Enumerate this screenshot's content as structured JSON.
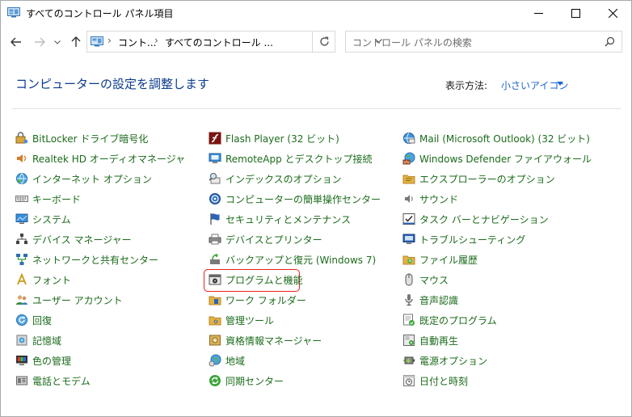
{
  "window": {
    "title": "すべてのコントロール パネル項目"
  },
  "address": {
    "crumbs": [
      "コント...",
      "すべてのコントロール ..."
    ],
    "search_placeholder": "コントロール パネルの検索"
  },
  "header": {
    "title": "コンピューターの設定を調整します",
    "view_label": "表示方法:",
    "view_value": "小さいアイコン"
  },
  "colors": {
    "link": "#1c6b1c",
    "accent": "#1a66d6",
    "highlight": "#e8221b"
  },
  "items": {
    "col1": [
      {
        "label": "BitLocker ドライブ暗号化",
        "icon": "bitlocker-icon"
      },
      {
        "label": "Realtek HD オーディオマネージャ",
        "icon": "speaker-icon"
      },
      {
        "label": "インターネット オプション",
        "icon": "globe-icon"
      },
      {
        "label": "キーボード",
        "icon": "keyboard-icon"
      },
      {
        "label": "システム",
        "icon": "monitor-icon"
      },
      {
        "label": "デバイス マネージャー",
        "icon": "device-manager-icon"
      },
      {
        "label": "ネットワークと共有センター",
        "icon": "network-icon"
      },
      {
        "label": "フォント",
        "icon": "font-icon"
      },
      {
        "label": "ユーザー アカウント",
        "icon": "users-icon"
      },
      {
        "label": "回復",
        "icon": "recovery-icon"
      },
      {
        "label": "記憶域",
        "icon": "storage-icon"
      },
      {
        "label": "色の管理",
        "icon": "color-icon"
      },
      {
        "label": "電話とモデム",
        "icon": "phone-icon"
      }
    ],
    "col2": [
      {
        "label": "Flash Player (32 ビット)",
        "icon": "flash-icon"
      },
      {
        "label": "RemoteApp とデスクトップ接続",
        "icon": "remoteapp-icon"
      },
      {
        "label": "インデックスのオプション",
        "icon": "index-icon"
      },
      {
        "label": "コンピューターの簡単操作センター",
        "icon": "accessibility-icon"
      },
      {
        "label": "セキュリティとメンテナンス",
        "icon": "flag-icon"
      },
      {
        "label": "デバイスとプリンター",
        "icon": "printer-icon"
      },
      {
        "label": "バックアップと復元 (Windows 7)",
        "icon": "backup-icon"
      },
      {
        "label": "プログラムと機能",
        "icon": "programs-icon"
      },
      {
        "label": "ワーク フォルダー",
        "icon": "work-folder-icon"
      },
      {
        "label": "管理ツール",
        "icon": "admin-tools-icon"
      },
      {
        "label": "資格情報マネージャー",
        "icon": "credential-icon"
      },
      {
        "label": "地域",
        "icon": "region-icon"
      },
      {
        "label": "同期センター",
        "icon": "sync-icon"
      }
    ],
    "col3": [
      {
        "label": "Mail (Microsoft Outlook) (32 ビット)",
        "icon": "mail-icon"
      },
      {
        "label": "Windows Defender ファイアウォール",
        "icon": "firewall-icon"
      },
      {
        "label": "エクスプローラーのオプション",
        "icon": "folder-options-icon"
      },
      {
        "label": "サウンド",
        "icon": "sound-icon"
      },
      {
        "label": "タスク バーとナビゲーション",
        "icon": "taskbar-icon"
      },
      {
        "label": "トラブルシューティング",
        "icon": "troubleshoot-icon"
      },
      {
        "label": "ファイル履歴",
        "icon": "file-history-icon"
      },
      {
        "label": "マウス",
        "icon": "mouse-icon"
      },
      {
        "label": "音声認識",
        "icon": "microphone-icon"
      },
      {
        "label": "既定のプログラム",
        "icon": "default-programs-icon"
      },
      {
        "label": "自動再生",
        "icon": "autoplay-icon"
      },
      {
        "label": "電源オプション",
        "icon": "power-icon"
      },
      {
        "label": "日付と時刻",
        "icon": "clock-icon"
      }
    ]
  }
}
